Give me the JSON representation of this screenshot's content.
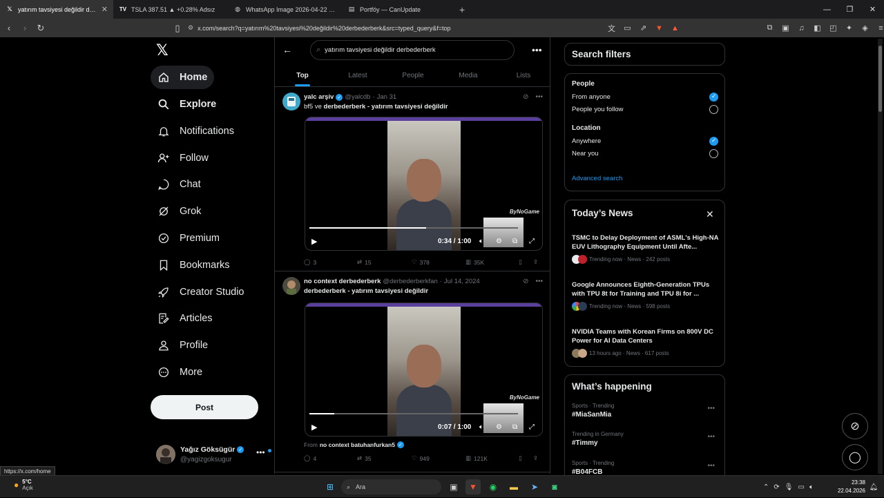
{
  "browser": {
    "tabs": [
      {
        "title": "yatırım tavsiyesi değildir derbede",
        "icon": "x",
        "active": true
      },
      {
        "title": "TSLA 387.51 ▲ +0.28% Adsız",
        "icon": "tradingview",
        "active": false
      },
      {
        "title": "WhatsApp Image 2026-04-22 at 22.3",
        "icon": "globe",
        "active": false
      },
      {
        "title": "Portföy — CanUpdate",
        "icon": "doc",
        "active": false
      }
    ],
    "url": "x.com/search?q=yatırım%20tavsiyesi%20değildir%20derbederberk&src=typed_query&f=top"
  },
  "nav": {
    "items": [
      {
        "label": "Home",
        "icon": "home-icon"
      },
      {
        "label": "Explore",
        "icon": "search-icon"
      },
      {
        "label": "Notifications",
        "icon": "bell-icon"
      },
      {
        "label": "Follow",
        "icon": "follow-icon"
      },
      {
        "label": "Chat",
        "icon": "chat-icon"
      },
      {
        "label": "Grok",
        "icon": "grok-icon"
      },
      {
        "label": "Premium",
        "icon": "premium-icon"
      },
      {
        "label": "Bookmarks",
        "icon": "bookmark-icon"
      },
      {
        "label": "Creator Studio",
        "icon": "rocket-icon"
      },
      {
        "label": "Articles",
        "icon": "articles-icon"
      },
      {
        "label": "Profile",
        "icon": "profile-icon"
      },
      {
        "label": "More",
        "icon": "more-icon"
      }
    ],
    "post_label": "Post",
    "account": {
      "name": "Yağız Göksügür",
      "handle": "@yagizgoksugur"
    },
    "status_url": "https://x.com/home"
  },
  "search": {
    "query": "yatırım tavsiyesi değildir derbederberk",
    "tabs": [
      "Top",
      "Latest",
      "People",
      "Media",
      "Lists"
    ]
  },
  "tweets": [
    {
      "name": "yalc arşiv",
      "handle": "@yalcdb",
      "date": "Jan 31",
      "text_plain": "bf5 ve ",
      "text_bold": "derbederberk - yatırım tavsiyesi değildir",
      "time": "0:34 / 1:00",
      "progress": 0.56,
      "replies": "3",
      "reposts": "15",
      "likes": "378",
      "views": "35K"
    },
    {
      "name": "no context derbederberk",
      "handle": "@derbederberkfan",
      "date": "Jul 14, 2024",
      "text_plain": "",
      "text_bold": "derbederberk - yatırım tavsiyesi değildir",
      "time": "0:07 / 1:00",
      "progress": 0.12,
      "from_prefix": "From",
      "from_name": "no context batuhanfurkan5",
      "replies": "4",
      "reposts": "35",
      "likes": "949",
      "views": "121K"
    }
  ],
  "filters": {
    "title": "Search filters",
    "people_label": "People",
    "people_options": [
      "From anyone",
      "People you follow"
    ],
    "people_selected": 0,
    "location_label": "Location",
    "location_options": [
      "Anywhere",
      "Near you"
    ],
    "location_selected": 0,
    "advanced": "Advanced search"
  },
  "news": {
    "title": "Today’s News",
    "items": [
      {
        "title": "TSMC to Delay Deployment of ASML's High-NA EUV Lithography Equipment Until Afte...",
        "meta": "Trending now · News · 242 posts"
      },
      {
        "title": "Google Announces Eighth-Generation TPUs with TPU 8t for Training and TPU 8i for ...",
        "meta": "Trending now · News · 598 posts"
      },
      {
        "title": "NVIDIA Teams with Korean Firms on 800V DC Power for AI Data Centers",
        "meta": "13 hours ago · News · 617 posts"
      }
    ]
  },
  "happening": {
    "title": "What’s happening",
    "trends": [
      {
        "category": "Sports · Trending",
        "tag": "#MiaSanMia"
      },
      {
        "category": "Trending in Germany",
        "tag": "#Timmy"
      },
      {
        "category": "Sports · Trending",
        "tag": "#B04FCB"
      }
    ]
  },
  "taskbar": {
    "temp": "5°C",
    "weather": "Açık",
    "search_placeholder": "Ara",
    "time": "23:38",
    "date": "22.04.2026"
  },
  "colors": {
    "accent": "#1d9bf0",
    "bg": "#000000",
    "border": "#2f3336",
    "muted": "#71767b"
  }
}
